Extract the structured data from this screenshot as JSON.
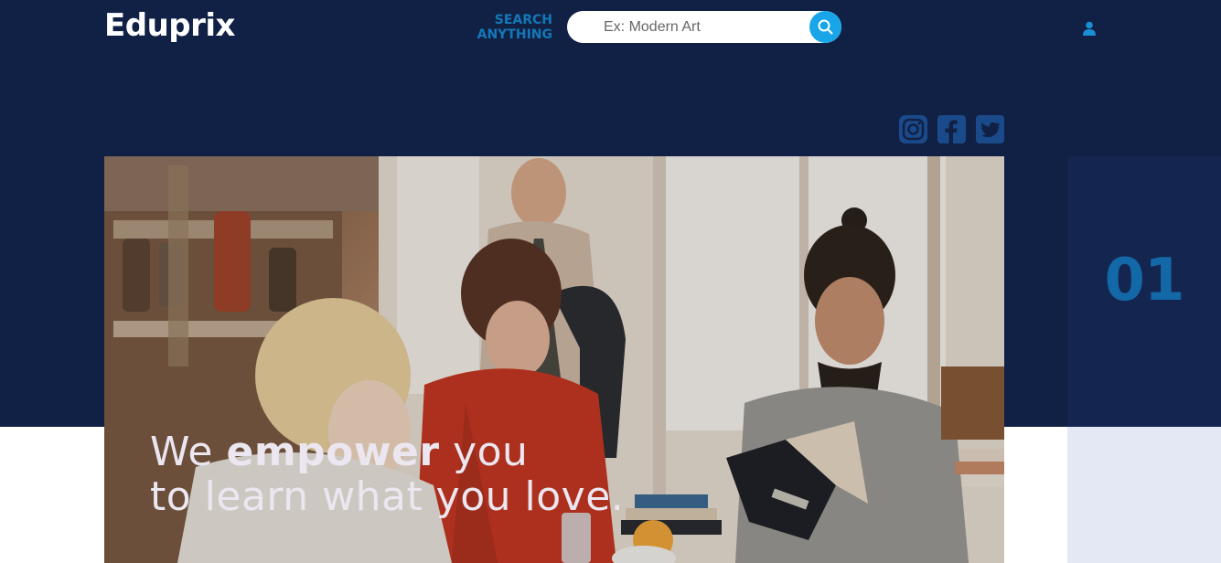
{
  "header": {
    "logo_text": "Eduprix",
    "search_label_line1": "SEARCH",
    "search_label_line2": "ANYTHING",
    "search_placeholder": "Ex: Modern Art",
    "search_icon": "search-icon",
    "user_icon": "user-icon"
  },
  "social": {
    "icons": [
      "instagram-icon",
      "facebook-icon",
      "twitter-icon"
    ]
  },
  "hero": {
    "image_description_icon": "hero-photo",
    "headline_part1": "We ",
    "headline_strong": "empower",
    "headline_part2": " you",
    "headline_line2": "to learn what you love."
  },
  "slider": {
    "current_slide": "01"
  },
  "colors": {
    "navy": "#112145",
    "panel": "#14264f",
    "accent": "#1378b8",
    "search_button": "#19a6e8",
    "light_panel": "#e4e7f4"
  }
}
